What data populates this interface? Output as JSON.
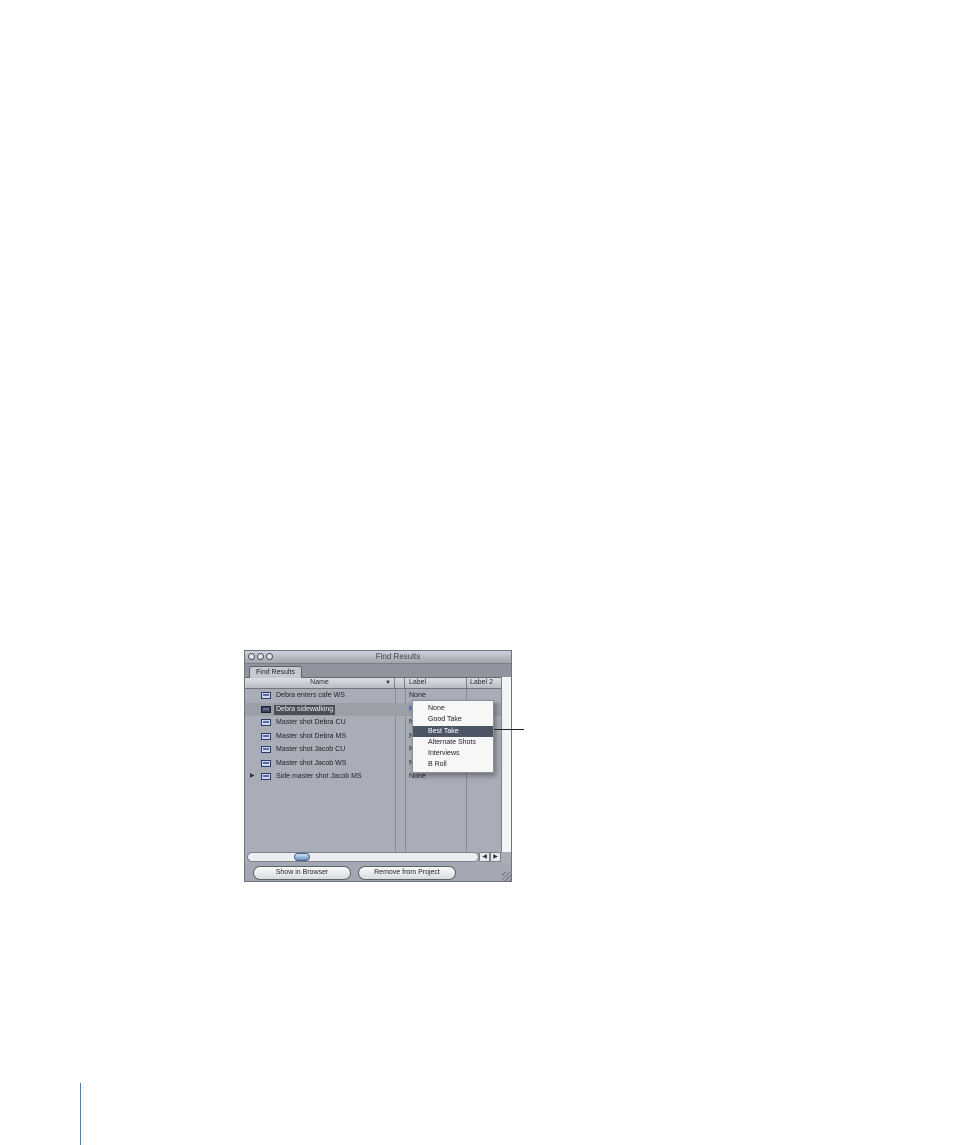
{
  "window": {
    "title": "Find Results",
    "tab": "Find Results",
    "columns": {
      "name": "Name",
      "label": "Label",
      "label2": "Label 2"
    },
    "rows": [
      {
        "name": "Debra enters cafe WS",
        "label": "None",
        "selected": false,
        "has_disclosure": false
      },
      {
        "name": "Debra sidewalking",
        "label": "N",
        "selected": true,
        "has_disclosure": false
      },
      {
        "name": "Master shot Debra CU",
        "label": "N",
        "selected": false,
        "has_disclosure": false
      },
      {
        "name": "Master shot Debra MS",
        "label": "N",
        "selected": false,
        "has_disclosure": false
      },
      {
        "name": "Master shot Jacob CU",
        "label": "N",
        "selected": false,
        "has_disclosure": false
      },
      {
        "name": "Master shot Jacob WS",
        "label": "N",
        "selected": false,
        "has_disclosure": false
      },
      {
        "name": "Side master shot Jacob MS",
        "label": "None",
        "selected": false,
        "has_disclosure": true
      }
    ],
    "buttons": {
      "show_in_browser": "Show in Browser",
      "remove_from_project": "Remove from Project"
    }
  },
  "popup_menu": {
    "items": [
      "None",
      "Good Take",
      "Best Take",
      "Alternate Shots",
      "Interviews",
      "B Roll"
    ],
    "highlighted": "Best Take"
  },
  "icons": {
    "disclosure": "disclosure-triangle-icon",
    "clip": "clip-icon",
    "sort": "sort-arrow-icon"
  },
  "colors": {
    "selection": "#4a4e57",
    "menu_highlight": "#4d5667",
    "active_label": "#1a2ed0",
    "page_rule": "#3f7fc8"
  }
}
